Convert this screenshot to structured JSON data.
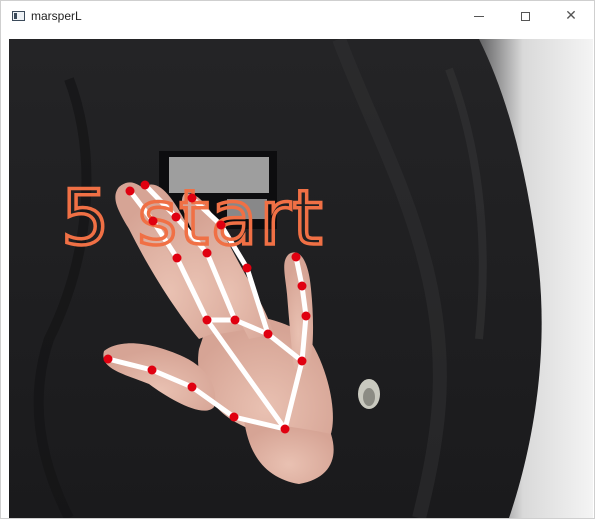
{
  "window": {
    "title": "marsperL"
  },
  "controls": {
    "minimize_icon": "minimize-icon",
    "maximize_icon": "maximize-icon",
    "close_icon": "close-icon",
    "close_glyph": "✕"
  },
  "overlay": {
    "text": "5 start",
    "text_color": "#f07045",
    "landmark_color": "#e00010",
    "connection_color": "#ffffff"
  }
}
